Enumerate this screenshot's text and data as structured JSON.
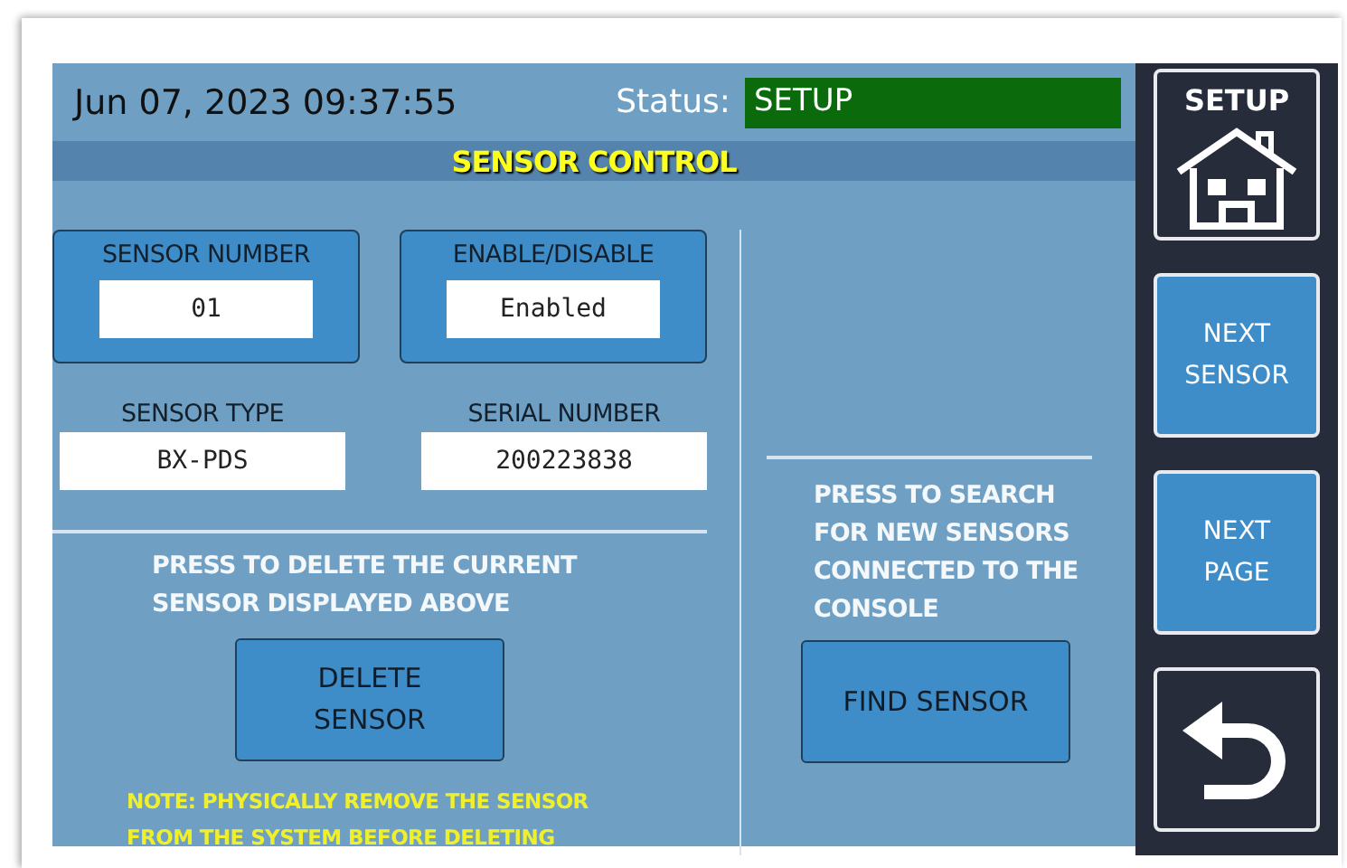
{
  "header": {
    "datetime": "Jun 07, 2023 09:37:55",
    "status_label": "Status:",
    "status_value": "SETUP",
    "title": "SENSOR CONTROL"
  },
  "fields": [
    {
      "label": "SENSOR NUMBER",
      "value": "01",
      "kind": "card"
    },
    {
      "label": "ENABLE/DISABLE",
      "value": "Enabled",
      "kind": "card"
    },
    {
      "label": "SENSOR TYPE",
      "value": "BX-PDS",
      "kind": "plain"
    },
    {
      "label": "SERIAL NUMBER",
      "value": "200223838",
      "kind": "plain"
    }
  ],
  "delete_section": {
    "instruction": "PRESS TO DELETE THE CURRENT SENSOR DISPLAYED ABOVE",
    "button": "DELETE SENSOR",
    "note": "NOTE: PHYSICALLY REMOVE THE SENSOR FROM THE SYSTEM BEFORE DELETING"
  },
  "find_section": {
    "instruction": "PRESS TO SEARCH FOR NEW SENSORS CONNECTED TO THE CONSOLE",
    "button": "FIND SENSOR"
  },
  "sidebar": [
    {
      "kind": "home",
      "label": "SETUP"
    },
    {
      "kind": "text",
      "label": "NEXT SENSOR"
    },
    {
      "kind": "text",
      "label": "NEXT PAGE"
    },
    {
      "kind": "back"
    }
  ]
}
